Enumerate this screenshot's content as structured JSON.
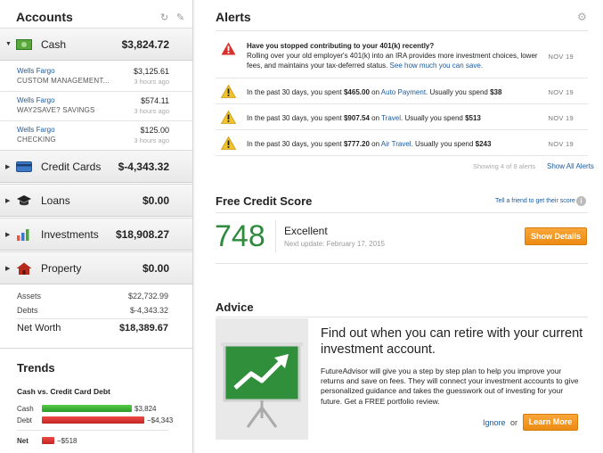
{
  "sidebar": {
    "title": "Accounts",
    "cash": {
      "label": "Cash",
      "amount": "$3,824.72"
    },
    "accounts": [
      {
        "name": "Wells Fargo",
        "sub": "CUSTOM MANAGEMENT...",
        "amount": "$3,125.61",
        "time": "3 hours ago"
      },
      {
        "name": "Wells Fargo",
        "sub": "WAY2SAVE? SAVINGS",
        "amount": "$574.11",
        "time": "3 hours ago"
      },
      {
        "name": "Wells Fargo",
        "sub": "CHECKING",
        "amount": "$125.00",
        "time": "3 hours ago"
      }
    ],
    "credit_cards": {
      "label": "Credit Cards",
      "amount": "$-4,343.32"
    },
    "loans": {
      "label": "Loans",
      "amount": "$0.00"
    },
    "investments": {
      "label": "Investments",
      "amount": "$18,908.27"
    },
    "property": {
      "label": "Property",
      "amount": "$0.00"
    },
    "summary": {
      "assets_label": "Assets",
      "assets": "$22,732.99",
      "debts_label": "Debts",
      "debts": "$-4,343.32",
      "net_worth_label": "Net Worth",
      "net_worth": "$18,389.67"
    },
    "trends": {
      "title": "Trends",
      "subtitle": "Cash vs. Credit Card Debt",
      "cash_label": "Cash",
      "cash_value": "$3,824",
      "debt_label": "Debt",
      "debt_value": "−$4,343",
      "net_label": "Net",
      "net_value": "−$518"
    }
  },
  "alerts": {
    "title": "Alerts",
    "items": [
      {
        "title": "Have you stopped contributing to your 401(k) recently?",
        "text": "Rolling over your old employer's 401(k) into an IRA provides more investment choices, lower fees, and maintains your tax-deferred status.",
        "link": "See how much you can save.",
        "date": "NOV 19"
      },
      {
        "pre": "In the past 30 days, you spent ",
        "amount": "$465.00",
        "mid": " on ",
        "category": "Auto Payment",
        "post": ". Usually you spend ",
        "usual": "$38",
        "date": "NOV 19"
      },
      {
        "pre": "In the past 30 days, you spent ",
        "amount": "$907.54",
        "mid": " on ",
        "category": "Travel",
        "post": ". Usually you spend ",
        "usual": "$513",
        "date": "NOV 19"
      },
      {
        "pre": "In the past 30 days, you spent ",
        "amount": "$777.20",
        "mid": " on ",
        "category": "Air Travel",
        "post": ". Usually you spend ",
        "usual": "$243",
        "date": "NOV 19"
      }
    ],
    "showing": "Showing 4 of 8 alerts",
    "show_all": "Show All Alerts"
  },
  "credit": {
    "title": "Free Credit Score",
    "tell_friend": "Tell a friend to get their score",
    "score": "748",
    "rating": "Excellent",
    "next_update": "Next update: February 17, 2015",
    "button": "Show Details"
  },
  "advice": {
    "title": "Advice",
    "headline": "Find out when you can retire with your current investment account.",
    "body": "FutureAdvisor will give you a step by step plan to help you improve your returns and save on fees. They will connect your investment accounts to give personalized guidance and takes the guesswork out of investing for your future. Get a FREE portfolio review.",
    "ignore": "Ignore",
    "or": "or",
    "learn_more": "Learn More"
  },
  "colors": {
    "link": "#1a5a9e",
    "score": "#2e8b3e",
    "orange": "#f29a22",
    "bar_green": "#3ab53a",
    "bar_red": "#d9302f"
  }
}
